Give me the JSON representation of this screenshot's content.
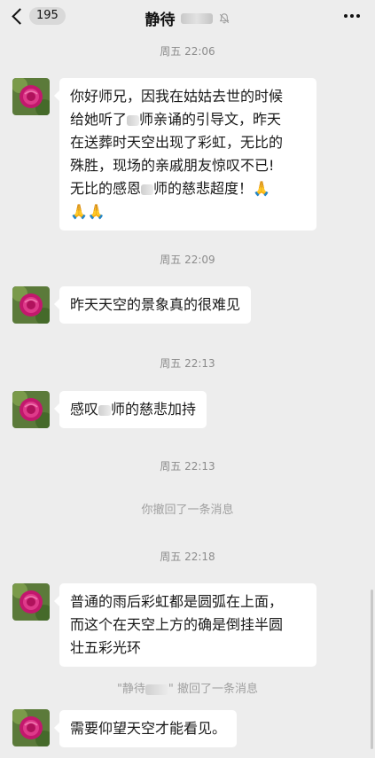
{
  "header": {
    "unread_count": "195",
    "title": "静待",
    "icons": [
      "back-chevron-icon",
      "mute-bell-icon",
      "more-icon"
    ]
  },
  "messages": {
    "t1": "周五 22:06",
    "m1_line1": "你好师兄，因我在姑姑去世的时候",
    "m1_line2a": "给她听了",
    "m1_line2b": "师亲诵的引导文，昨天",
    "m1_line3": "在送葬时天空出现了彩虹，无比的",
    "m1_line4": "殊胜，现场的亲戚朋友惊叹不已!",
    "m1_line5a": "无比的感恩",
    "m1_line5b": "师的慈悲超度！🙏",
    "m1_line6": "🙏🙏",
    "t2": "周五 22:09",
    "m2": "昨天天空的景象真的很难见",
    "t3": "周五 22:13",
    "m3a": "感叹",
    "m3b": "师的慈悲加持",
    "t4": "周五 22:13",
    "sys1": "你撤回了一条消息",
    "t5": "周五 22:18",
    "m4_line1": "普通的雨后彩虹都是圆弧在上面，",
    "m4_line2": "而这个在天空上方的确是倒挂半圆",
    "m4_line3": "壮五彩光环",
    "sys2a": "\"静待",
    "sys2b": "\" 撤回了一条消息",
    "m5": "需要仰望天空才能看见。"
  },
  "colors": {
    "background": "#ededed",
    "bubble": "#ffffff",
    "time_text": "#8c8c8c"
  }
}
